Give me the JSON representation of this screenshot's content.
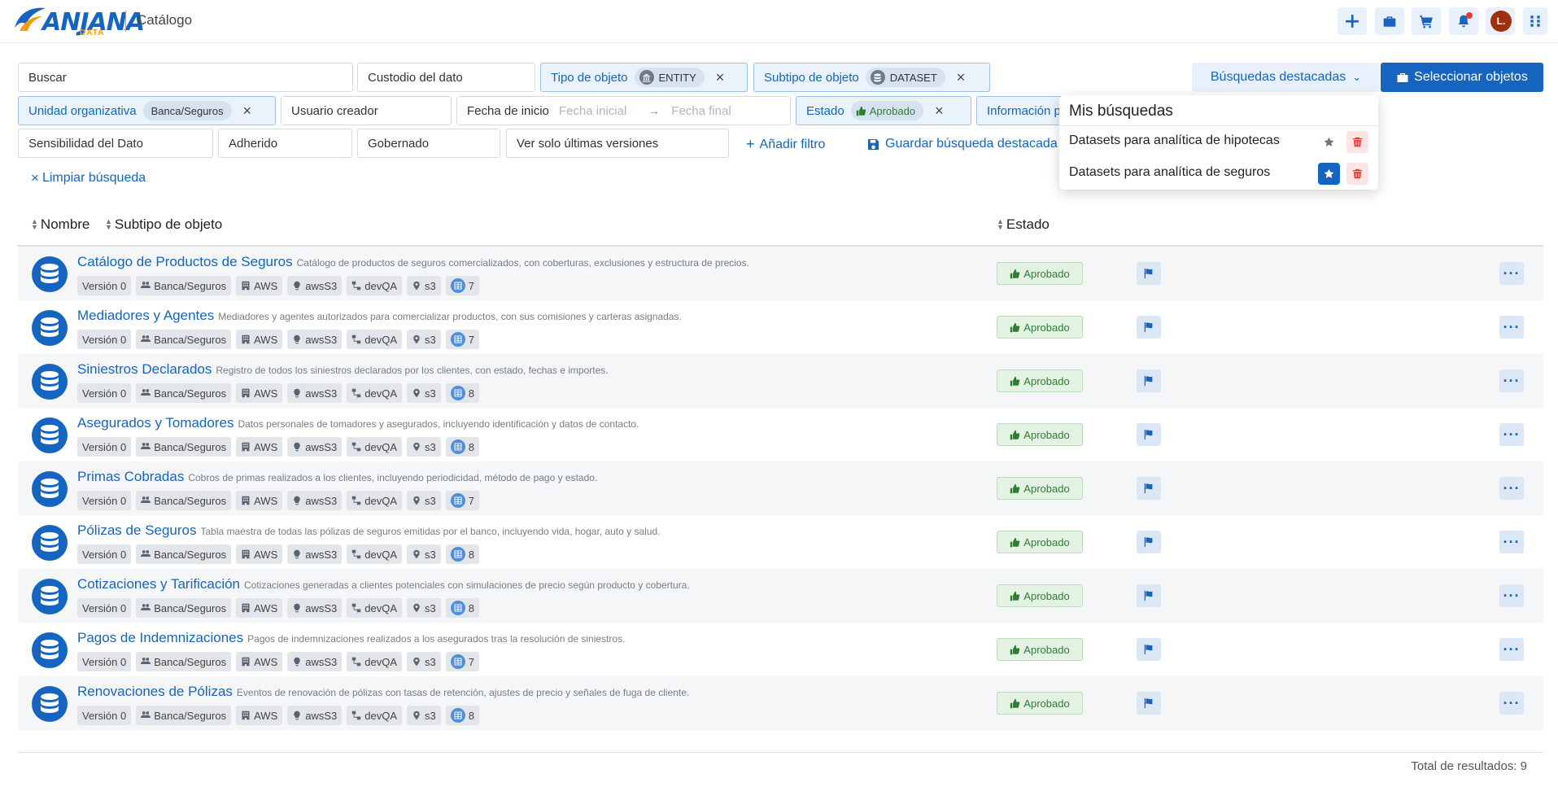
{
  "header": {
    "logo_text": "ANJANA",
    "logo_sub": "DATA",
    "title": "Catálogo",
    "avatar_initial": "L."
  },
  "filters": {
    "search_label": "Buscar",
    "custodian_label": "Custodio del dato",
    "object_type_label": "Tipo de objeto",
    "object_type_value": "ENTITY",
    "object_subtype_label": "Subtipo de objeto",
    "object_subtype_value": "DATASET",
    "org_unit_label": "Unidad organizativa",
    "org_unit_value": "Banca/Seguros",
    "creator_label": "Usuario creador",
    "start_date_label": "Fecha de inicio",
    "start_date_from_placeholder": "Fecha inicial",
    "start_date_to_placeholder": "Fecha final",
    "status_label": "Estado",
    "status_value": "Aprobado",
    "info_label": "Información p",
    "sensitivity_label": "Sensibilidad del Dato",
    "adhered_label": "Adherido",
    "governed_label": "Gobernado",
    "latest_versions_label": "Ver solo últimas versiones",
    "add_filter_label": "Añadir filtro",
    "save_search_label": "Guardar búsqueda destacada",
    "clear_search_label": "Limpiar búsqueda"
  },
  "actions": {
    "featured_searches_label": "Búsquedas destacadas",
    "select_objects_label": "Seleccionar objetos"
  },
  "dropdown": {
    "title": "Mis búsquedas",
    "items": [
      {
        "label": "Datasets para analítica de hipotecas",
        "starred": false
      },
      {
        "label": "Datasets para analítica de seguros",
        "starred": true
      }
    ]
  },
  "table": {
    "columns": {
      "name": "Nombre",
      "subtype": "Subtipo de objeto",
      "status": "Estado"
    },
    "rows": [
      {
        "title": "Catálogo de Productos de Seguros",
        "description": "Catálogo de productos de seguros comercializados, con coberturas, exclusiones y estructura de precios.",
        "version": "Versión 0",
        "org": "Banca/Seguros",
        "provider": "AWS",
        "source": "awsS3",
        "env": "devQA",
        "location": "s3",
        "count": "7",
        "status": "Aprobado"
      },
      {
        "title": "Mediadores y Agentes",
        "description": "Mediadores y agentes autorizados para comercializar productos, con sus comisiones y carteras asignadas.",
        "version": "Versión 0",
        "org": "Banca/Seguros",
        "provider": "AWS",
        "source": "awsS3",
        "env": "devQA",
        "location": "s3",
        "count": "7",
        "status": "Aprobado"
      },
      {
        "title": "Siniestros Declarados",
        "description": "Registro de todos los siniestros declarados por los clientes, con estado, fechas e importes.",
        "version": "Versión 0",
        "org": "Banca/Seguros",
        "provider": "AWS",
        "source": "awsS3",
        "env": "devQA",
        "location": "s3",
        "count": "8",
        "status": "Aprobado"
      },
      {
        "title": "Asegurados y Tomadores",
        "description": "Datos personales de tomadores y asegurados, incluyendo identificación y datos de contacto.",
        "version": "Versión 0",
        "org": "Banca/Seguros",
        "provider": "AWS",
        "source": "awsS3",
        "env": "devQA",
        "location": "s3",
        "count": "8",
        "status": "Aprobado"
      },
      {
        "title": "Primas Cobradas",
        "description": "Cobros de primas realizados a los clientes, incluyendo periodicidad, método de pago y estado.",
        "version": "Versión 0",
        "org": "Banca/Seguros",
        "provider": "AWS",
        "source": "awsS3",
        "env": "devQA",
        "location": "s3",
        "count": "7",
        "status": "Aprobado"
      },
      {
        "title": "Pólizas de Seguros",
        "description": "Tabla maestra de todas las pólizas de seguros emitidas por el banco, incluyendo vida, hogar, auto y salud.",
        "version": "Versión 0",
        "org": "Banca/Seguros",
        "provider": "AWS",
        "source": "awsS3",
        "env": "devQA",
        "location": "s3",
        "count": "8",
        "status": "Aprobado"
      },
      {
        "title": "Cotizaciones y Tarificación",
        "description": "Cotizaciones generadas a clientes potenciales con simulaciones de precio según producto y cobertura.",
        "version": "Versión 0",
        "org": "Banca/Seguros",
        "provider": "AWS",
        "source": "awsS3",
        "env": "devQA",
        "location": "s3",
        "count": "8",
        "status": "Aprobado"
      },
      {
        "title": "Pagos de Indemnizaciones",
        "description": "Pagos de indemnizaciones realizados a los asegurados tras la resolución de siniestros.",
        "version": "Versión 0",
        "org": "Banca/Seguros",
        "provider": "AWS",
        "source": "awsS3",
        "env": "devQA",
        "location": "s3",
        "count": "7",
        "status": "Aprobado"
      },
      {
        "title": "Renovaciones de Pólizas",
        "description": "Eventos de renovación de pólizas con tasas de retención, ajustes de precio y señales de fuga de cliente.",
        "version": "Versión 0",
        "org": "Banca/Seguros",
        "provider": "AWS",
        "source": "awsS3",
        "env": "devQA",
        "location": "s3",
        "count": "8",
        "status": "Aprobado"
      }
    ]
  },
  "footer": {
    "total_results": "Total de resultados: 9"
  },
  "colors": {
    "brand": "#1565c0",
    "approved": "#2e7d32",
    "danger": "#e53935"
  }
}
